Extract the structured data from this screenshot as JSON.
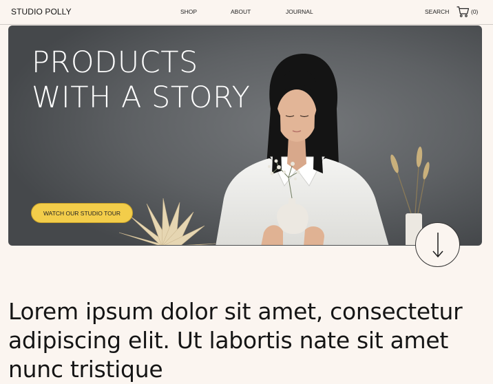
{
  "header": {
    "logo": "STUDIO POLLY",
    "nav": {
      "shop": "SHOP",
      "about": "ABOUT",
      "journal": "JOURNAL"
    },
    "search": "SEARCH",
    "cart_icon": "shopping-cart-icon",
    "cart_count": "(0)"
  },
  "hero": {
    "title_line1": "PRODUCTS",
    "title_line2": "WITH A STORY",
    "cta_label": "WATCH OUR STUDIO TOUR",
    "cta_color": "#f3cd4a",
    "scroll_icon": "arrow-down-icon"
  },
  "main": {
    "intro_text": "Lorem ipsum dolor sit amet, consectetur adipiscing elit. Ut labortis nate sit amet nunc tristique"
  },
  "colors": {
    "page_background": "#fbf5f0",
    "text": "#151515"
  }
}
